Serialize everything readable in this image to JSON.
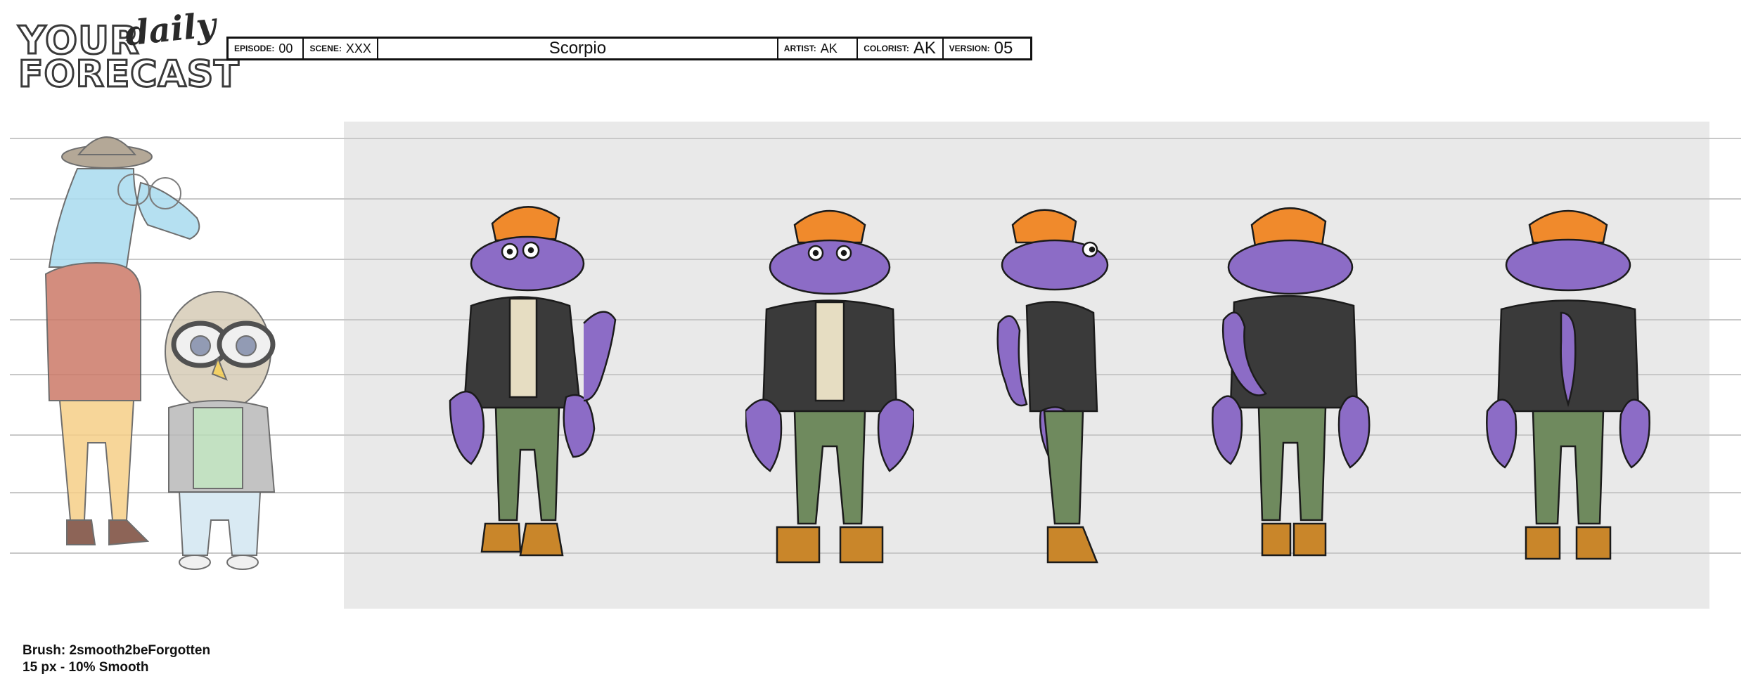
{
  "logo": {
    "line1": "YOUR",
    "script": "daily",
    "line2": "FORECAST"
  },
  "header": {
    "episode_label": "EPISODE:",
    "episode_value": "00",
    "scene_label": "SCENE:",
    "scene_value": "XXX",
    "title": "Scorpio",
    "artist_label": "ARTIST:",
    "artist_value": "AK",
    "colorist_label": "COLORIST:",
    "colorist_value": "AK",
    "version_label": "VERSION:",
    "version_value": "05"
  },
  "views": [
    "front-3/4",
    "front",
    "side",
    "back-3/4",
    "back"
  ],
  "colors": {
    "skin": "#8c6cc6",
    "skin_dark": "#6b4fa6",
    "hat": "#f08a2c",
    "jacket": "#3a3a3a",
    "shirt": "#e6ddc2",
    "pants": "#6f8a5e",
    "boots": "#c9862a",
    "stage": "#e9e9e9",
    "guide": "#c8c8c8",
    "dolphin": "#a9dbef",
    "dolphin_sweater": "#cc7a68",
    "owl": "#d6ccb7"
  },
  "notes": {
    "brush": "Brush: 2smooth2beForgotten",
    "settings": "15 px - 10%  Smooth"
  }
}
